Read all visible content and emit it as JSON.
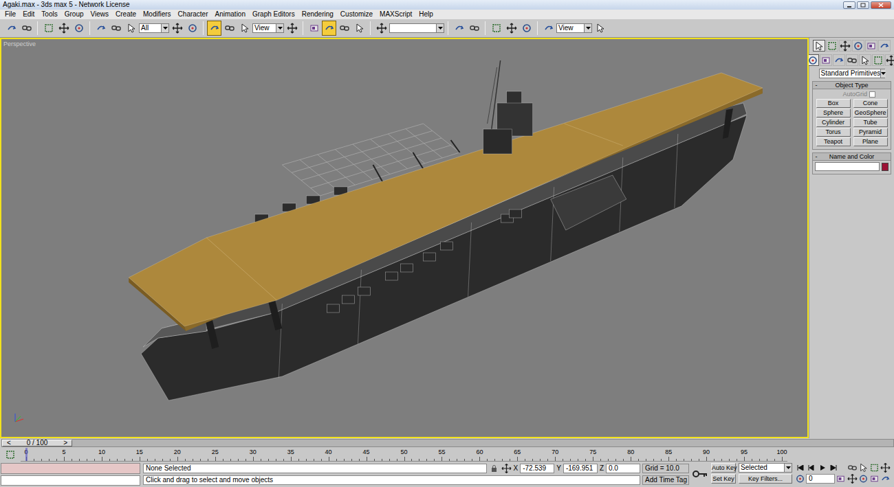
{
  "window": {
    "title": "Agaki.max - 3ds max 5 - Network License"
  },
  "menu": [
    "File",
    "Edit",
    "Tools",
    "Group",
    "Views",
    "Create",
    "Modifiers",
    "Character",
    "Animation",
    "Graph Editors",
    "Rendering",
    "Customize",
    "MAXScript",
    "Help"
  ],
  "toolbar": [
    {
      "kind": "icon",
      "selected": false
    },
    {
      "kind": "icon",
      "selected": false
    },
    {
      "kind": "separator"
    },
    {
      "kind": "icon",
      "selected": false
    },
    {
      "kind": "icon",
      "selected": false
    },
    {
      "kind": "icon",
      "selected": false
    },
    {
      "kind": "separator"
    },
    {
      "kind": "icon",
      "selected": false
    },
    {
      "kind": "icon",
      "selected": false
    },
    {
      "kind": "icon",
      "selected": false
    },
    {
      "kind": "dropdown",
      "value": "All"
    },
    {
      "kind": "icon",
      "selected": false
    },
    {
      "kind": "icon",
      "selected": false
    },
    {
      "kind": "separator"
    },
    {
      "kind": "icon",
      "selected": true
    },
    {
      "kind": "icon",
      "selected": false
    },
    {
      "kind": "icon",
      "selected": false
    },
    {
      "kind": "dropdown",
      "value": "View"
    },
    {
      "kind": "icon",
      "selected": false
    },
    {
      "kind": "separator"
    },
    {
      "kind": "icon",
      "selected": false
    },
    {
      "kind": "icon",
      "selected": true
    },
    {
      "kind": "icon",
      "selected": false
    },
    {
      "kind": "icon",
      "selected": false
    },
    {
      "kind": "separator"
    },
    {
      "kind": "icon",
      "selected": false
    },
    {
      "kind": "dropdown",
      "value": ""
    },
    {
      "kind": "separator"
    },
    {
      "kind": "icon",
      "selected": false
    },
    {
      "kind": "icon",
      "selected": false
    },
    {
      "kind": "separator"
    },
    {
      "kind": "icon",
      "selected": false
    },
    {
      "kind": "icon",
      "selected": false
    },
    {
      "kind": "icon",
      "selected": false
    },
    {
      "kind": "separator"
    },
    {
      "kind": "icon",
      "selected": false
    },
    {
      "kind": "dropdown",
      "value": "View"
    },
    {
      "kind": "icon",
      "selected": false
    }
  ],
  "viewport": {
    "label": "Perspective",
    "active": true
  },
  "command_panel": {
    "tabs": [
      {
        "selected": true
      },
      {
        "selected": false
      },
      {
        "selected": false
      },
      {
        "selected": false
      },
      {
        "selected": false
      },
      {
        "selected": false
      }
    ],
    "subtabs": [
      {
        "selected": true
      },
      {
        "selected": false
      },
      {
        "selected": false
      },
      {
        "selected": false
      },
      {
        "selected": false
      },
      {
        "selected": false
      },
      {
        "selected": false
      }
    ],
    "category": "Standard Primitives",
    "object_type": {
      "toggle": "-",
      "title": "Object Type",
      "autogrid": {
        "label": "AutoGrid",
        "checked": false,
        "disabled": true
      },
      "buttons": [
        "Box",
        "Cone",
        "Sphere",
        "GeoSphere",
        "Cylinder",
        "Tube",
        "Torus",
        "Pyramid",
        "Teapot",
        "Plane"
      ]
    },
    "name_and_color": {
      "toggle": "-",
      "title": "Name and Color",
      "name": "",
      "color": "#9c1236"
    }
  },
  "time_slider": {
    "label": "0 / 100",
    "prev": "<",
    "next": ">",
    "level": 0
  },
  "track_bar": {
    "labels": [
      "0",
      "5",
      "10",
      "15",
      "20",
      "25",
      "30",
      "35",
      "40",
      "45",
      "50",
      "55",
      "60",
      "65",
      "70",
      "75",
      "80",
      "85",
      "90",
      "95",
      "100"
    ],
    "current": 0
  },
  "status": {
    "selection": "None Selected",
    "prompt": "Click and drag to select and move objects",
    "x_label": "X",
    "x": "-72.539",
    "y_label": "Y",
    "y": "-169.951",
    "z_label": "Z",
    "z": "0.0",
    "grid": "Grid = 10.0",
    "time_tag": "Add Time Tag",
    "auto_key": "Auto Key",
    "set_key": "Set Key",
    "key_mode": "Selected",
    "key_filters": "Key Filters...",
    "frame": "0"
  }
}
